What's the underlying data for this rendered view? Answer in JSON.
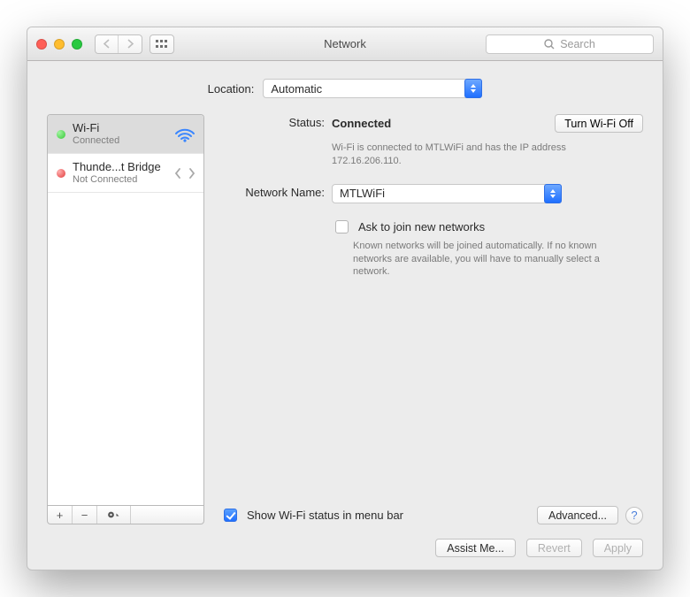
{
  "titlebar": {
    "title": "Network",
    "search_placeholder": "Search"
  },
  "location": {
    "label": "Location:",
    "value": "Automatic"
  },
  "services": [
    {
      "name": "Wi-Fi",
      "state": "Connected",
      "dot": "green",
      "icon": "wifi",
      "selected": true
    },
    {
      "name": "Thunde...t Bridge",
      "state": "Not Connected",
      "dot": "red",
      "icon": "bridge",
      "selected": false
    }
  ],
  "detail": {
    "status_label": "Status:",
    "status_value": "Connected",
    "turn_off_label": "Turn Wi-Fi Off",
    "status_desc": "Wi-Fi is connected to MTLWiFi and has the IP address 172.16.206.110.",
    "network_name_label": "Network Name:",
    "network_name_value": "MTLWiFi",
    "ask_label": "Ask to join new networks",
    "ask_desc": "Known networks will be joined automatically. If no known networks are available, you will have to manually select a network.",
    "show_status_label": "Show Wi-Fi status in menu bar",
    "show_status_checked": true,
    "advanced_label": "Advanced...",
    "help_label": "?"
  },
  "footer": {
    "assist": "Assist Me...",
    "revert": "Revert",
    "apply": "Apply"
  }
}
